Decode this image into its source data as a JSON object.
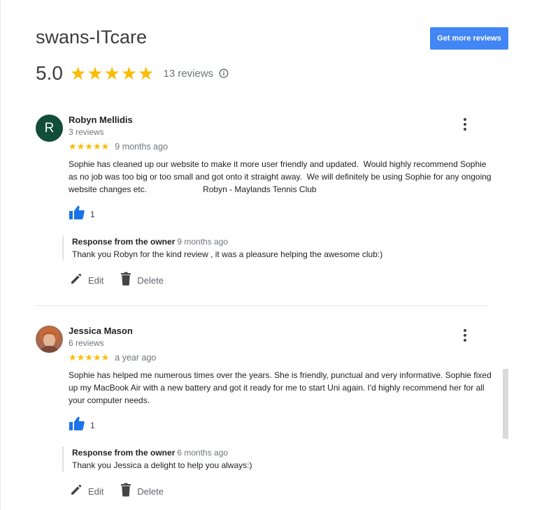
{
  "business": {
    "name": "swans-ITcare",
    "rating": "5.0",
    "stars": "★★★★★",
    "review_count": "13 reviews",
    "get_reviews_label": "Get more reviews"
  },
  "colors": {
    "accent": "#4285f4",
    "star": "#fbbc04",
    "avatar_robyn": "#124d3a",
    "like_icon": "#1a73e8"
  },
  "reviews": [
    {
      "initial": "R",
      "name": "Robyn Mellidis",
      "meta": "3 reviews",
      "stars": "★★★★★",
      "time": "9 months ago",
      "text": "Sophie has cleaned up our website to make it more user friendly and updated.  Would highly recommend Sophie as no job was too big or too small and got onto it straight away.  We will definitely be using Sophie for any ongoing website changes etc.                        Robyn - Maylands Tennis Club",
      "likes": "1",
      "response": {
        "label": "Response from the owner",
        "time": "9 months ago",
        "text": "Thank you Robyn for the kind review , it was a pleasure helping the awesome club:)"
      }
    },
    {
      "initial": "",
      "name": "Jessica Mason",
      "meta": "6 reviews",
      "stars": "★★★★★",
      "time": "a year ago",
      "text": "Sophie has helped me numerous times over the years. She is friendly, punctual and very informative. Sophie fixed up my MacBook Air with a new battery and got it ready for me to start Uni again. I'd highly recommend her for all your computer needs.",
      "likes": "1",
      "response": {
        "label": "Response from the owner",
        "time": "6 months ago",
        "text": "Thank you Jessica a delight to help you always:)"
      }
    }
  ],
  "actions": {
    "edit": "Edit",
    "delete": "Delete"
  },
  "icons": {
    "info": "info-icon",
    "more": "more-vert-icon",
    "like": "thumbs-up-icon",
    "edit": "pencil-icon",
    "delete": "trash-icon"
  }
}
